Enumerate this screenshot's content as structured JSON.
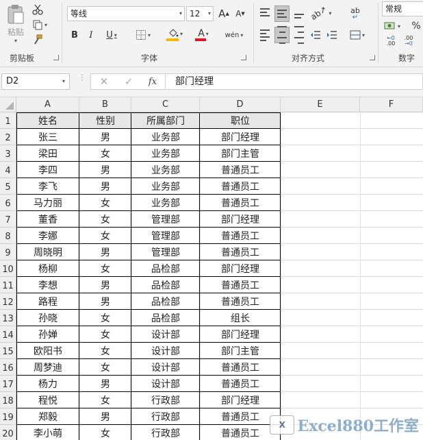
{
  "ribbon": {
    "clipboard": {
      "label": "剪贴板",
      "paste_label": "粘贴"
    },
    "font": {
      "label": "字体",
      "font_name": "等线",
      "font_size": "12",
      "bold": "B",
      "italic": "I",
      "underline": "U",
      "grow": "A",
      "shrink": "A",
      "font_color": "A",
      "phonetic": "wén"
    },
    "alignment": {
      "label": "对齐方式",
      "wrap": "ab"
    },
    "number": {
      "label": "数字",
      "format": "常规",
      "percent": "%",
      "inc_decimal": ".00",
      "dec_decimal": ".00"
    }
  },
  "formula_bar": {
    "name_box": "D2",
    "fx": "fx",
    "content": "部门经理"
  },
  "sheet": {
    "columns": [
      "A",
      "B",
      "C",
      "D",
      "E",
      "F"
    ],
    "rows": [
      [
        "姓名",
        "性别",
        "所属部门",
        "职位"
      ],
      [
        "张三",
        "男",
        "业务部",
        "部门经理"
      ],
      [
        "梁田",
        "女",
        "业务部",
        "部门主管"
      ],
      [
        "李四",
        "男",
        "业务部",
        "普通员工"
      ],
      [
        "李飞",
        "男",
        "业务部",
        "普通员工"
      ],
      [
        "马力丽",
        "女",
        "业务部",
        "普通员工"
      ],
      [
        "董香",
        "女",
        "管理部",
        "部门经理"
      ],
      [
        "李娜",
        "女",
        "管理部",
        "普通员工"
      ],
      [
        "周晓明",
        "男",
        "管理部",
        "普通员工"
      ],
      [
        "杨柳",
        "女",
        "品检部",
        "部门经理"
      ],
      [
        "李想",
        "男",
        "品检部",
        "普通员工"
      ],
      [
        "路程",
        "男",
        "品检部",
        "普通员工"
      ],
      [
        "孙晓",
        "女",
        "品检部",
        "组长"
      ],
      [
        "孙婵",
        "女",
        "设计部",
        "部门经理"
      ],
      [
        "欧阳书",
        "女",
        "设计部",
        "部门主管"
      ],
      [
        "周梦迪",
        "女",
        "设计部",
        "普通员工"
      ],
      [
        "杨力",
        "男",
        "设计部",
        "普通员工"
      ],
      [
        "程悦",
        "女",
        "行政部",
        "部门经理"
      ],
      [
        "郑毅",
        "男",
        "行政部",
        "普通员工"
      ],
      [
        "李小萌",
        "女",
        "行政部",
        "普通员工"
      ]
    ],
    "selected_cell": "D2"
  },
  "watermark": {
    "badge": "X",
    "text": "Excel880工作室"
  }
}
